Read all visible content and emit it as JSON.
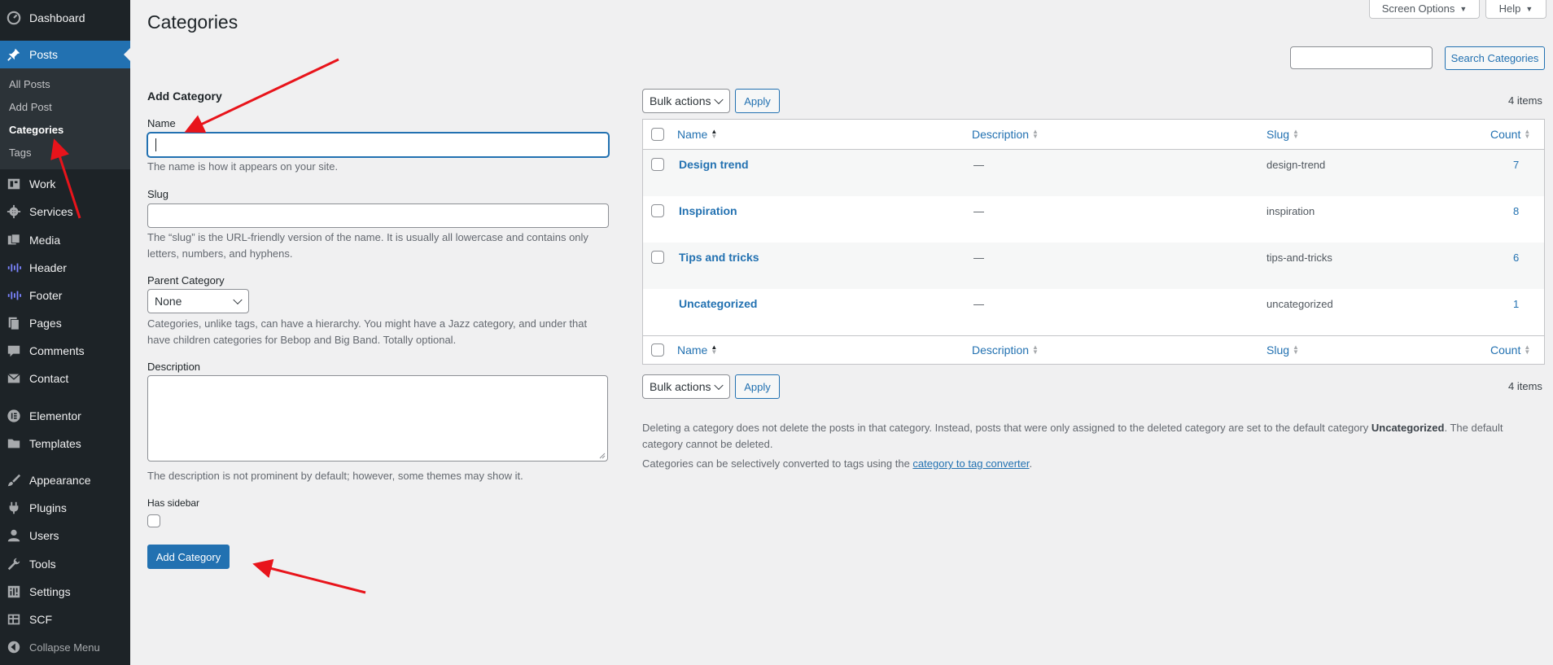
{
  "sidebar": {
    "items": [
      {
        "label": "Dashboard",
        "icon": "dashboard-icon"
      },
      {
        "label": "Posts",
        "icon": "pin-icon",
        "current": true
      },
      {
        "label": "Work",
        "icon": "portfolio-icon"
      },
      {
        "label": "Services",
        "icon": "gear-icon"
      },
      {
        "label": "Media",
        "icon": "media-icon"
      },
      {
        "label": "Header",
        "icon": "waveform-icon"
      },
      {
        "label": "Footer",
        "icon": "waveform-icon"
      },
      {
        "label": "Pages",
        "icon": "pages-icon"
      },
      {
        "label": "Comments",
        "icon": "comment-icon"
      },
      {
        "label": "Contact",
        "icon": "envelope-icon"
      },
      {
        "label": "Elementor",
        "icon": "elementor-icon"
      },
      {
        "label": "Templates",
        "icon": "folder-icon"
      },
      {
        "label": "Appearance",
        "icon": "paintbrush-icon"
      },
      {
        "label": "Plugins",
        "icon": "plugin-icon"
      },
      {
        "label": "Users",
        "icon": "user-icon"
      },
      {
        "label": "Tools",
        "icon": "wrench-icon"
      },
      {
        "label": "Settings",
        "icon": "settings-icon"
      },
      {
        "label": "SCF",
        "icon": "table-icon"
      },
      {
        "label": "Collapse Menu",
        "icon": "collapse-icon"
      }
    ],
    "submenu": [
      {
        "label": "All Posts"
      },
      {
        "label": "Add Post"
      },
      {
        "label": "Categories",
        "current": true
      },
      {
        "label": "Tags"
      }
    ]
  },
  "header": {
    "title": "Categories",
    "screen_options": "Screen Options",
    "help": "Help"
  },
  "search": {
    "value": "",
    "button": "Search Categories"
  },
  "form": {
    "heading": "Add Category",
    "name_label": "Name",
    "name_value": "",
    "name_desc": "The name is how it appears on your site.",
    "slug_label": "Slug",
    "slug_value": "",
    "slug_desc": "The “slug” is the URL-friendly version of the name. It is usually all lowercase and contains only letters, numbers, and hyphens.",
    "parent_label": "Parent Category",
    "parent_value": "None",
    "parent_desc": "Categories, unlike tags, can have a hierarchy. You might have a Jazz category, and under that have children categories for Bebop and Big Band. Totally optional.",
    "description_label": "Description",
    "description_desc": "The description is not prominent by default; however, some themes may show it.",
    "sidebar_label": "Has sidebar",
    "submit": "Add Category"
  },
  "table": {
    "bulk_actions": "Bulk actions",
    "apply": "Apply",
    "items_count": "4 items",
    "columns": [
      "Name",
      "Description",
      "Slug",
      "Count"
    ],
    "rows": [
      {
        "name": "Design trend",
        "description": "—",
        "slug": "design-trend",
        "count": "7"
      },
      {
        "name": "Inspiration",
        "description": "—",
        "slug": "inspiration",
        "count": "8"
      },
      {
        "name": "Tips and tricks",
        "description": "—",
        "slug": "tips-and-tricks",
        "count": "6"
      },
      {
        "name": "Uncategorized",
        "description": "—",
        "slug": "uncategorized",
        "count": "1"
      }
    ]
  },
  "notes": {
    "delete_pre": "Deleting a category does not delete the posts in that category. Instead, posts that were only assigned to the deleted category are set to the default category ",
    "delete_bold": "Uncategorized",
    "delete_post": ". The default category cannot be deleted.",
    "convert_pre": "Categories can be selectively converted to tags using the ",
    "convert_link": "category to tag converter",
    "convert_post": "."
  },
  "colors": {
    "sidebar_bg": "#1d2327",
    "accent": "#2271b1",
    "annotation_arrow": "#e8141b"
  }
}
